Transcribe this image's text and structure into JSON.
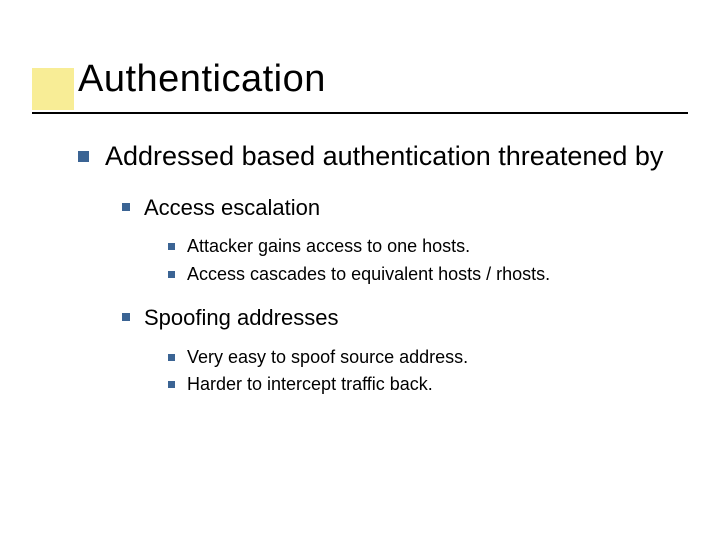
{
  "title": "Authentication",
  "bullet1": "Addressed based authentication threatened by",
  "sub1": "Access escalation",
  "sub1_items": {
    "a": "Attacker gains access to one hosts.",
    "b": "Access cascades to equivalent hosts / rhosts."
  },
  "sub2": "Spoofing addresses",
  "sub2_items": {
    "a": "Very easy to spoof source address.",
    "b": "Harder to intercept traffic back."
  }
}
